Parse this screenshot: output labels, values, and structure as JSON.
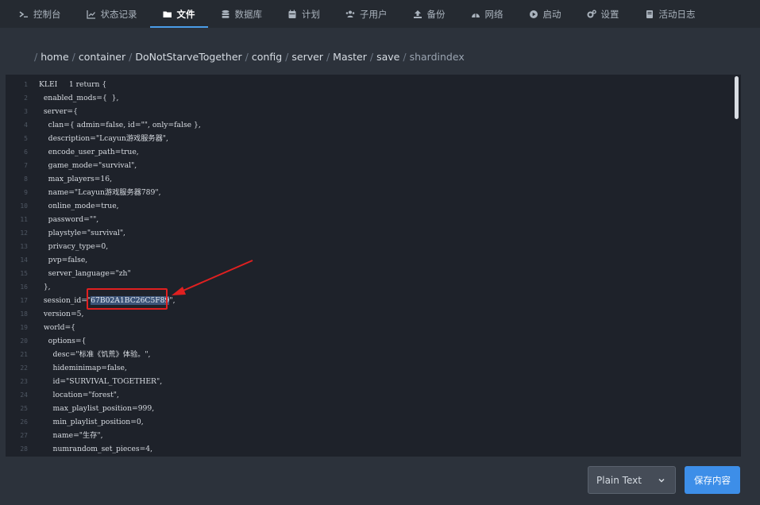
{
  "nav": {
    "items": [
      {
        "label": "控制台",
        "icon": "terminal-icon"
      },
      {
        "label": "状态记录",
        "icon": "chart-icon"
      },
      {
        "label": "文件",
        "icon": "folder-icon",
        "active": true
      },
      {
        "label": "数据库",
        "icon": "database-icon"
      },
      {
        "label": "计划",
        "icon": "calendar-icon"
      },
      {
        "label": "子用户",
        "icon": "users-icon"
      },
      {
        "label": "备份",
        "icon": "upload-icon"
      },
      {
        "label": "网络",
        "icon": "network-icon"
      },
      {
        "label": "启动",
        "icon": "play-icon"
      },
      {
        "label": "设置",
        "icon": "gears-icon"
      },
      {
        "label": "活动日志",
        "icon": "book-icon"
      }
    ]
  },
  "breadcrumb": {
    "root_sep": "/",
    "parts": [
      "home",
      "container",
      "DoNotStarveTogether",
      "config",
      "server",
      "Master",
      "save",
      "shardindex"
    ]
  },
  "editor": {
    "lines": [
      "KLEI     1 return {",
      "  enabled_mods={  },",
      "  server={",
      "    clan={ admin=false, id=\"\", only=false },",
      "    description=\"Lcayun游戏服务器\",",
      "    encode_user_path=true,",
      "    game_mode=\"survival\",",
      "    max_players=16,",
      "    name=\"Lcayun游戏服务器789\",",
      "    online_mode=true,",
      "    password=\"\",",
      "    playstyle=\"survival\",",
      "    privacy_type=0,",
      "    pvp=false,",
      "    server_language=\"zh\"",
      "  },",
      "  session_id=\"67B02A1BC26C5F89\",",
      "  version=5,",
      "  world={",
      "    options={",
      "      desc=\"标准《饥荒》体验。\",",
      "      hideminimap=false,",
      "      id=\"SURVIVAL_TOGETHER\",",
      "      location=\"forest\",",
      "      max_playlist_position=999,",
      "      min_playlist_position=0,",
      "      name=\"生存\",",
      "      numrandom_set_pieces=4,"
    ],
    "selected_value": "67B02A1BC26C5F89",
    "highlight_color": "#e02020"
  },
  "footer": {
    "language": "Plain Text",
    "save_label": "保存内容"
  },
  "colors": {
    "accent": "#3d8ee8",
    "background": "#2c323b",
    "editor_bg": "#1e222a"
  }
}
